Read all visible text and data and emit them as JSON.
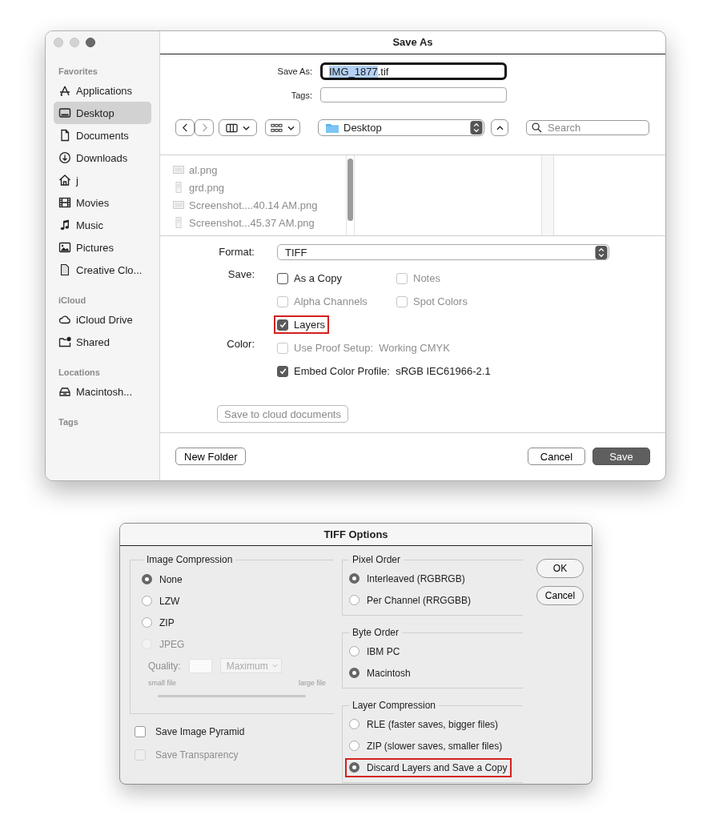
{
  "save_dialog": {
    "title": "Save As",
    "sidebar": {
      "sections": [
        {
          "heading": "Favorites",
          "items": [
            {
              "label": "Applications",
              "kind": "applications",
              "selected": false
            },
            {
              "label": "Desktop",
              "kind": "desktop",
              "selected": true
            },
            {
              "label": "Documents",
              "kind": "document",
              "selected": false
            },
            {
              "label": "Downloads",
              "kind": "download",
              "selected": false
            },
            {
              "label": "j",
              "kind": "home",
              "selected": false
            },
            {
              "label": "Movies",
              "kind": "movies",
              "selected": false
            },
            {
              "label": "Music",
              "kind": "music",
              "selected": false
            },
            {
              "label": "Pictures",
              "kind": "pictures",
              "selected": false
            },
            {
              "label": "Creative Clo...",
              "kind": "file",
              "selected": false
            }
          ]
        },
        {
          "heading": "iCloud",
          "items": [
            {
              "label": "iCloud Drive",
              "kind": "cloud",
              "selected": false
            },
            {
              "label": "Shared",
              "kind": "shared",
              "selected": false
            }
          ]
        },
        {
          "heading": "Locations",
          "items": [
            {
              "label": "Macintosh...",
              "kind": "drive",
              "selected": false
            }
          ]
        },
        {
          "heading": "Tags"
        }
      ]
    },
    "save_as": {
      "label": "Save As:",
      "value_parts": [
        {
          "text": "IMG_1877",
          "selected": true
        },
        {
          "text": ".tif",
          "selected": false
        }
      ]
    },
    "tags": {
      "label": "Tags:"
    },
    "location": "Desktop",
    "search": {
      "placeholder": "Search"
    },
    "files": [
      {
        "name": "al.png",
        "kind": "wide",
        "disabled": true
      },
      {
        "name": "grd.png",
        "kind": "tall",
        "disabled": true
      },
      {
        "name": "Screenshot....40.14 AM.png",
        "kind": "wide",
        "disabled": true
      },
      {
        "name": "Screenshot...45.37 AM.png",
        "kind": "tall",
        "disabled": true
      }
    ],
    "format": {
      "label": "Format:",
      "value": "TIFF"
    },
    "save_options": {
      "label": "Save:",
      "items": [
        {
          "label": "As a Copy",
          "checked": false,
          "disabled": false,
          "highlighted": false
        },
        {
          "label": "Notes",
          "checked": false,
          "disabled": true,
          "highlighted": false
        },
        {
          "label": "Alpha Channels",
          "checked": false,
          "disabled": true,
          "highlighted": false
        },
        {
          "label": "Spot Colors",
          "checked": false,
          "disabled": true,
          "highlighted": false
        },
        {
          "label": "Layers",
          "checked": true,
          "disabled": false,
          "highlighted": true
        }
      ]
    },
    "color_options": {
      "label": "Color:",
      "items": [
        {
          "label": "Use Proof Setup:  Working CMYK",
          "checked": false,
          "disabled": true,
          "highlighted": false
        },
        {
          "label": "Embed Color Profile:  sRGB IEC61966-2.1",
          "checked": true,
          "disabled": false,
          "highlighted": false
        }
      ]
    },
    "cloud_button": {
      "label": "Save to cloud documents",
      "disabled": true
    },
    "buttons": {
      "new_folder": "New Folder",
      "cancel": "Cancel",
      "save": "Save"
    }
  },
  "tiff_dialog": {
    "title": "TIFF Options",
    "image_compression": {
      "title": "Image Compression",
      "options": [
        {
          "label": "None",
          "selected": true,
          "disabled": false
        },
        {
          "label": "LZW",
          "selected": false,
          "disabled": false
        },
        {
          "label": "ZIP",
          "selected": false,
          "disabled": false
        },
        {
          "label": "JPEG",
          "selected": false,
          "disabled": true
        }
      ],
      "quality_label": "Quality:",
      "quality_preset": "Maximum",
      "small_label": "small file",
      "large_label": "large file"
    },
    "checkboxes": [
      {
        "label": "Save Image Pyramid",
        "checked": false,
        "disabled": false
      },
      {
        "label": "Save Transparency",
        "checked": false,
        "disabled": true
      }
    ],
    "groups": [
      {
        "title": "Pixel Order",
        "options": [
          {
            "label": "Interleaved (RGBRGB)",
            "selected": true,
            "highlighted": false
          },
          {
            "label": "Per Channel (RRGGBB)",
            "selected": false,
            "highlighted": false
          }
        ]
      },
      {
        "title": "Byte Order",
        "options": [
          {
            "label": "IBM PC",
            "selected": false,
            "highlighted": false
          },
          {
            "label": "Macintosh",
            "selected": true,
            "highlighted": false
          }
        ]
      },
      {
        "title": "Layer Compression",
        "options": [
          {
            "label": "RLE (faster saves, bigger files)",
            "selected": false,
            "highlighted": false
          },
          {
            "label": "ZIP (slower saves, smaller files)",
            "selected": false,
            "highlighted": false
          },
          {
            "label": "Discard Layers and Save a Copy",
            "selected": true,
            "highlighted": true
          }
        ]
      }
    ],
    "buttons": [
      "OK",
      "Cancel"
    ]
  }
}
